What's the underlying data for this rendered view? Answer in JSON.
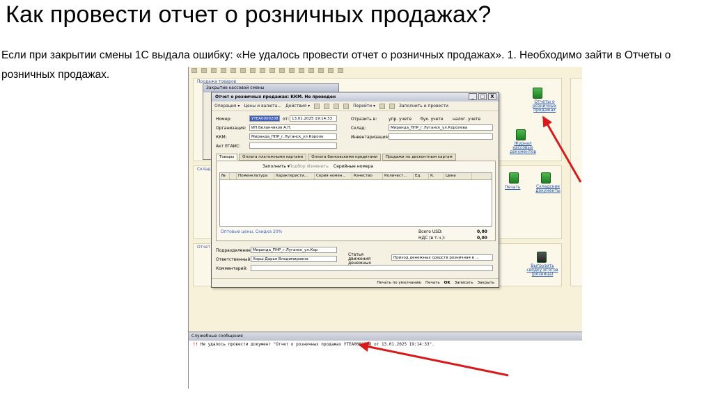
{
  "slide": {
    "title": "Как провести отчет о розничных продажах?",
    "text": "Если при закрытии смены 1С выдала ошибку: «Не удалось провести отчет о розничных продажах». 1. Необходимо зайти в Отчеты о розничных продажах."
  },
  "background_panel": {
    "section_sales": "Продажа товаров",
    "section_warehouse": "Склад",
    "section_reports": "Отчет",
    "link_reports": "Отчеты о розничных продажах",
    "link_cash_docs": "Журнал кассовых документов",
    "link_print": "Печать",
    "link_warehouse_docs": "Складские документы",
    "link_unload": "Выгрузить сводку итогов (розница)"
  },
  "back_dialog": {
    "title": "Закрытие кассовой смены"
  },
  "dialog": {
    "title": "Отчет о розничных продажах: ККМ. Не проведен",
    "win_controls": [
      "_",
      "□",
      "X"
    ],
    "toolbar": {
      "operation": "Операция ▾",
      "prices": "Цены и валюта...",
      "actions": "Действия ▾",
      "goto": "Перейти ▾",
      "fill_post": "Заполнить и провести"
    },
    "fields": {
      "number_label": "Номер:",
      "number_value": "УТЕА0000208",
      "date_label": "от:",
      "date_value": "13.01.2025 19:14:33",
      "org_label": "Организация:",
      "org_value": "ИП Беланчиков А.П.",
      "kkm_label": "ККМ:",
      "kkm_value": "Миранда_ПНР_г.Луганск_ул.Короле",
      "egais_label": "Акт ЕГАИС:",
      "reflect_label": "Отразить в:",
      "reflect_opts": [
        "упр. учете",
        "бух. учете",
        "налог. учете"
      ],
      "warehouse_label": "Склад:",
      "warehouse_value": "Миранда_ПНР_г.Луганск_ул.Королева",
      "inventory_label": "Инвентаризация:"
    },
    "tabs": [
      "Товары",
      "Оплата платежными картами",
      "Оплата банковскими кредитами",
      "Продажи по дисконтным картам"
    ],
    "grid_toolbar": {
      "fill": "Заполнить ▾",
      "select": "Подбор",
      "change": "Изменить",
      "serials": "Серийные номера"
    },
    "grid_columns": [
      "№",
      "",
      "Номенклатура",
      "Характеристи...",
      "Серия номен...",
      "Качество",
      "Количест...",
      "Ед.",
      "К.",
      "Цена"
    ],
    "price_note": "Оптовые цены, Скидка 20%",
    "total_label": "Всего USD:",
    "total_value": "0,00",
    "vat_label": "НДС (в т.ч.):",
    "vat_value": "0,00",
    "division_label": "Подразделение:",
    "division_value": "Миранда_ПНР_г.Луганск_ул.Кор",
    "responsible_label": "Ответственный:",
    "responsible_value": "Хорш Дарья Владимировна",
    "cash_flow_label": "Статья движения денежных средств:",
    "cash_flow_value": "Приход денежных средств розничная в ...",
    "comment_label": "Комментарий:",
    "bottom": {
      "print_default": "Печать по умолчанию",
      "print": "Печать",
      "ok": "OK",
      "save": "Записать",
      "close": "Закрыть"
    }
  },
  "messages": {
    "header": "Служебные сообщения",
    "marker": "!!",
    "text": "Не удалось провести документ \"Отчет о розничных продажах УТЕА0000208 от 13.01.2025 19:14:33\"."
  },
  "colors": {
    "arrow": "#d81a1a",
    "screenshot_bg": "#f6f1d8",
    "selected_field": "#3f5fbe"
  }
}
